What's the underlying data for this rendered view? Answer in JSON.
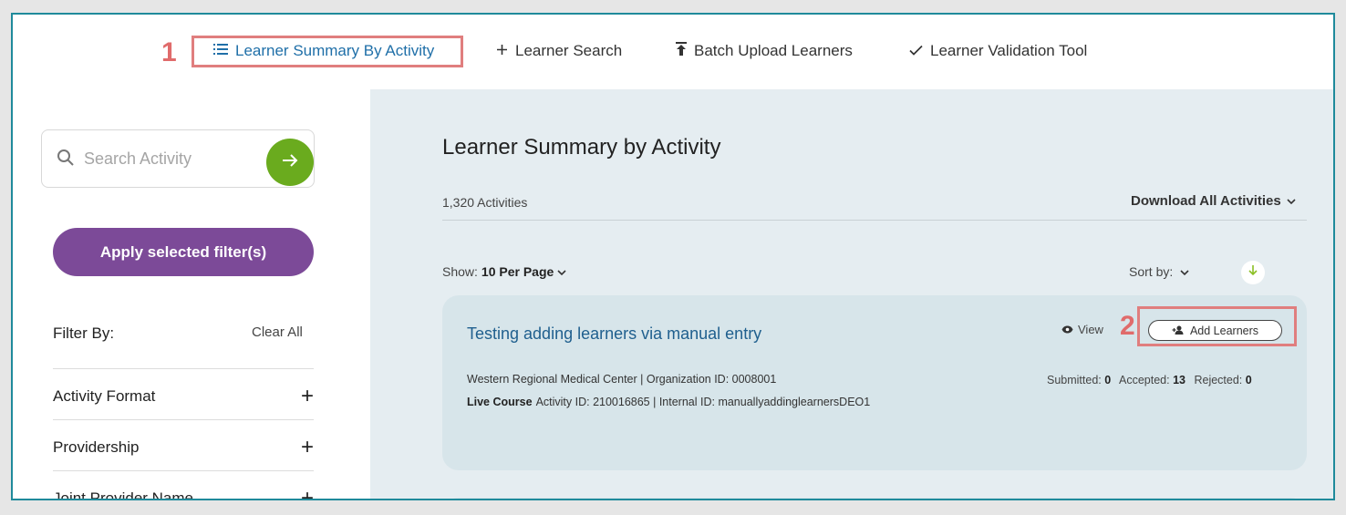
{
  "nav": {
    "items": [
      {
        "label": "Learner Summary By Activity",
        "active": true
      },
      {
        "label": "Learner Search"
      },
      {
        "label": "Batch Upload Learners"
      },
      {
        "label": "Learner Validation Tool"
      }
    ]
  },
  "callouts": {
    "one": "1",
    "two": "2"
  },
  "sidebar": {
    "search_placeholder": "Search Activity",
    "apply_label": "Apply selected filter(s)",
    "filter_by": "Filter By:",
    "clear_all": "Clear All",
    "filters": [
      "Activity Format",
      "Providership",
      "Joint Provider Name"
    ]
  },
  "main": {
    "title": "Learner Summary by Activity",
    "count": "1,320 Activities",
    "download_label": "Download All Activities",
    "show_label": "Show:",
    "show_value": "10 Per Page",
    "sort_label": "Sort by:"
  },
  "card": {
    "title": "Testing adding learners via manual entry",
    "org": "Western Regional Medical Center | Organization ID: 0008001",
    "format": "Live Course",
    "ids": "Activity ID: 210016865 | Internal ID: manuallyaddinglearnersDEO1",
    "view_label": "View",
    "add_label": "Add Learners",
    "submitted_label": "Submitted:",
    "submitted": "0",
    "accepted_label": "Accepted:",
    "accepted": "13",
    "rejected_label": "Rejected:",
    "rejected": "0"
  },
  "colors": {
    "accent_green": "#6aab1e",
    "apply_purple": "#7c4a98",
    "link_blue": "#1f6fa8",
    "callout_red": "#e06b6b",
    "frame_teal": "#1f8a9b"
  }
}
